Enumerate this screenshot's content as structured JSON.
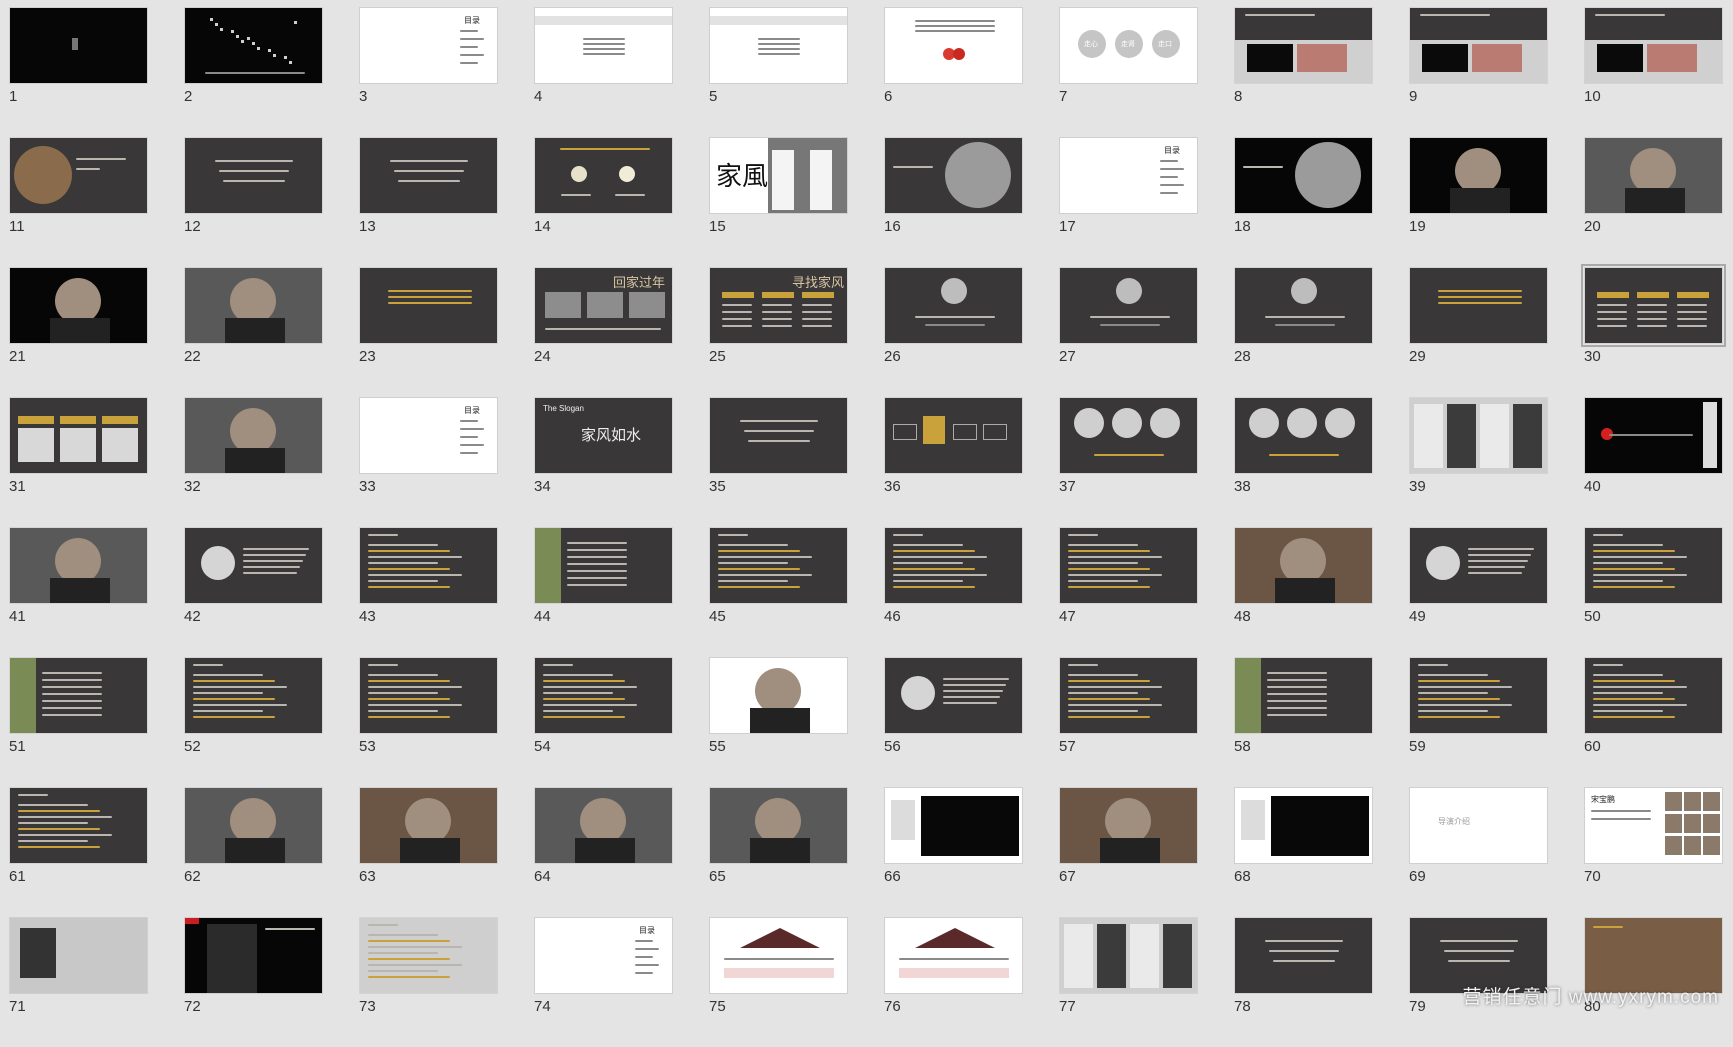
{
  "watermark": "营销任意门 www.yxrym.com",
  "selected_slide": 30,
  "slides": [
    {
      "n": "1",
      "t": "black",
      "v": "glyph"
    },
    {
      "n": "2",
      "t": "black",
      "v": "network"
    },
    {
      "n": "3",
      "t": "white",
      "v": "toc",
      "title": "目录"
    },
    {
      "n": "4",
      "t": "white",
      "v": "textbar"
    },
    {
      "n": "5",
      "t": "white",
      "v": "textbar"
    },
    {
      "n": "6",
      "t": "white",
      "v": "lanterns"
    },
    {
      "n": "7",
      "t": "white",
      "v": "three-circles",
      "circles": [
        "走心",
        "走肾",
        "走口"
      ]
    },
    {
      "n": "8",
      "t": "dark",
      "v": "photos-strip"
    },
    {
      "n": "9",
      "t": "dark",
      "v": "photos-strip"
    },
    {
      "n": "10",
      "t": "dark",
      "v": "photos-strip"
    },
    {
      "n": "11",
      "t": "dark",
      "v": "food"
    },
    {
      "n": "12",
      "t": "dark",
      "v": "text-center"
    },
    {
      "n": "13",
      "t": "dark",
      "v": "text-center"
    },
    {
      "n": "14",
      "t": "dark",
      "v": "bulbs"
    },
    {
      "n": "15",
      "t": "white",
      "v": "jiafeng",
      "title": "家風"
    },
    {
      "n": "16",
      "t": "dark",
      "v": "watch"
    },
    {
      "n": "17",
      "t": "white",
      "v": "toc",
      "title": "目录"
    },
    {
      "n": "18",
      "t": "black",
      "v": "watch"
    },
    {
      "n": "19",
      "t": "black",
      "v": "portrait"
    },
    {
      "n": "20",
      "t": "photo",
      "v": "portrait"
    },
    {
      "n": "21",
      "t": "black",
      "v": "portrait"
    },
    {
      "n": "22",
      "t": "photo",
      "v": "portrait"
    },
    {
      "n": "23",
      "t": "dark",
      "v": "yellow-text"
    },
    {
      "n": "24",
      "t": "dark",
      "v": "photo-row",
      "title": "回家过年"
    },
    {
      "n": "25",
      "t": "dark",
      "v": "cols3",
      "title": "寻找家风"
    },
    {
      "n": "26",
      "t": "dark",
      "v": "one-circle"
    },
    {
      "n": "27",
      "t": "dark",
      "v": "one-circle"
    },
    {
      "n": "28",
      "t": "dark",
      "v": "one-circle"
    },
    {
      "n": "29",
      "t": "dark",
      "v": "yellow-text"
    },
    {
      "n": "30",
      "t": "dark",
      "v": "cols3"
    },
    {
      "n": "31",
      "t": "dark",
      "v": "cols3-photos"
    },
    {
      "n": "32",
      "t": "photo",
      "v": "portrait"
    },
    {
      "n": "33",
      "t": "white",
      "v": "toc",
      "title": "目录"
    },
    {
      "n": "34",
      "t": "dark",
      "v": "slogan",
      "title": "The Slogan",
      "slogan": "家风如水"
    },
    {
      "n": "35",
      "t": "dark",
      "v": "text-center"
    },
    {
      "n": "36",
      "t": "dark",
      "v": "flow"
    },
    {
      "n": "37",
      "t": "dark",
      "v": "three-portraits"
    },
    {
      "n": "38",
      "t": "dark",
      "v": "three-portraits"
    },
    {
      "n": "39",
      "t": "gray",
      "v": "collage"
    },
    {
      "n": "40",
      "t": "black",
      "v": "redline"
    },
    {
      "n": "41",
      "t": "photo",
      "v": "portrait"
    },
    {
      "n": "42",
      "t": "dark",
      "v": "circle-text"
    },
    {
      "n": "43",
      "t": "dark",
      "v": "doc"
    },
    {
      "n": "44",
      "t": "dark",
      "v": "doc-photo"
    },
    {
      "n": "45",
      "t": "dark",
      "v": "doc"
    },
    {
      "n": "46",
      "t": "dark",
      "v": "doc"
    },
    {
      "n": "47",
      "t": "dark",
      "v": "doc"
    },
    {
      "n": "48",
      "t": "warm",
      "v": "portrait"
    },
    {
      "n": "49",
      "t": "dark",
      "v": "circle-text"
    },
    {
      "n": "50",
      "t": "dark",
      "v": "doc"
    },
    {
      "n": "51",
      "t": "dark",
      "v": "doc-photo"
    },
    {
      "n": "52",
      "t": "dark",
      "v": "doc"
    },
    {
      "n": "53",
      "t": "dark",
      "v": "doc"
    },
    {
      "n": "54",
      "t": "dark",
      "v": "doc"
    },
    {
      "n": "55",
      "t": "white",
      "v": "portrait"
    },
    {
      "n": "56",
      "t": "dark",
      "v": "circle-text"
    },
    {
      "n": "57",
      "t": "dark",
      "v": "doc"
    },
    {
      "n": "58",
      "t": "dark",
      "v": "doc-photo"
    },
    {
      "n": "59",
      "t": "dark",
      "v": "doc"
    },
    {
      "n": "60",
      "t": "dark",
      "v": "doc"
    },
    {
      "n": "61",
      "t": "dark",
      "v": "doc"
    },
    {
      "n": "62",
      "t": "photo",
      "v": "portrait"
    },
    {
      "n": "63",
      "t": "warm",
      "v": "portrait"
    },
    {
      "n": "64",
      "t": "photo",
      "v": "portrait"
    },
    {
      "n": "65",
      "t": "photo",
      "v": "portrait"
    },
    {
      "n": "66",
      "t": "white",
      "v": "video"
    },
    {
      "n": "67",
      "t": "warm",
      "v": "portrait"
    },
    {
      "n": "68",
      "t": "white",
      "v": "video"
    },
    {
      "n": "69",
      "t": "white",
      "v": "label",
      "title": "导演介绍"
    },
    {
      "n": "70",
      "t": "white",
      "v": "gallery",
      "title": "宋宝鹏"
    },
    {
      "n": "71",
      "t": "white",
      "v": "ink"
    },
    {
      "n": "72",
      "t": "black",
      "v": "director"
    },
    {
      "n": "73",
      "t": "gray",
      "v": "doc"
    },
    {
      "n": "74",
      "t": "white",
      "v": "toc",
      "title": "目录"
    },
    {
      "n": "75",
      "t": "white",
      "v": "house"
    },
    {
      "n": "76",
      "t": "white",
      "v": "house"
    },
    {
      "n": "77",
      "t": "gray",
      "v": "collage"
    },
    {
      "n": "78",
      "t": "dark",
      "v": "text-center"
    },
    {
      "n": "79",
      "t": "dark",
      "v": "text-center"
    },
    {
      "n": "80",
      "t": "warm",
      "v": "shop"
    }
  ]
}
